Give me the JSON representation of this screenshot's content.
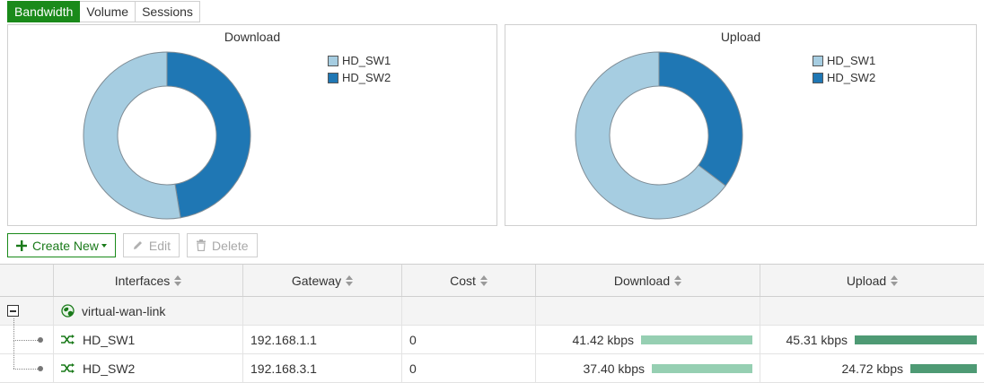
{
  "tabs": [
    {
      "label": "Bandwidth",
      "active": true
    },
    {
      "label": "Volume",
      "active": false
    },
    {
      "label": "Sessions",
      "active": false
    }
  ],
  "colors": {
    "series1": "#a6cde1",
    "series2": "#1f77b4",
    "download_bar": "#96cfb2",
    "upload_bar": "#4e9a74",
    "accent": "#1a8a1a"
  },
  "chart_data": [
    {
      "type": "pie",
      "title": "Download",
      "categories": [
        "HD_SW1",
        "HD_SW2"
      ],
      "values": [
        52.6,
        47.4
      ],
      "donut": true,
      "legend": "top-right"
    },
    {
      "type": "pie",
      "title": "Upload",
      "categories": [
        "HD_SW1",
        "HD_SW2"
      ],
      "values": [
        64.7,
        35.3
      ],
      "donut": true,
      "legend": "top-right"
    }
  ],
  "toolbar": {
    "create_new": "Create New",
    "edit": "Edit",
    "delete": "Delete"
  },
  "table": {
    "headers": [
      "Interfaces",
      "Gateway",
      "Cost",
      "Download",
      "Upload"
    ],
    "group": {
      "name": "virtual-wan-link"
    },
    "rows": [
      {
        "interface": "HD_SW1",
        "gateway": "192.168.1.1",
        "cost": "0",
        "download": "41.42 kbps",
        "download_value": 41.42,
        "upload": "45.31 kbps",
        "upload_value": 45.31
      },
      {
        "interface": "HD_SW2",
        "gateway": "192.168.3.1",
        "cost": "0",
        "download": "37.40 kbps",
        "download_value": 37.4,
        "upload": "24.72 kbps",
        "upload_value": 24.72
      }
    ]
  }
}
